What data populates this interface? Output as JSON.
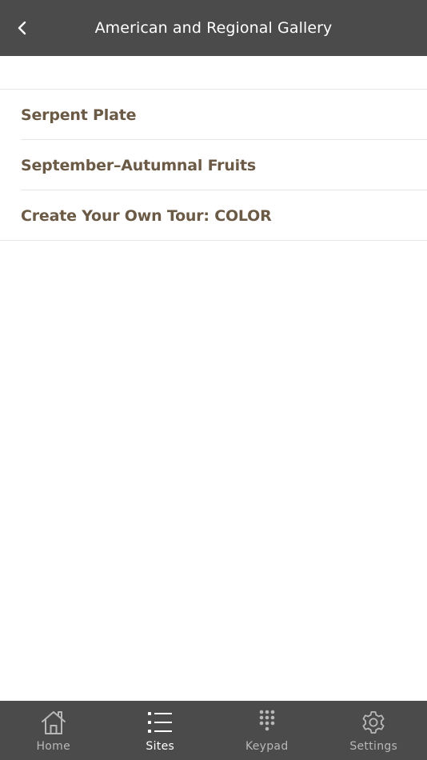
{
  "header": {
    "title": "American and Regional Gallery",
    "back_icon": "chevron-left-icon"
  },
  "list": {
    "items": [
      {
        "label": "Serpent Plate"
      },
      {
        "label": "September–Autumnal Fruits"
      },
      {
        "label": "Create Your Own Tour: COLOR"
      }
    ]
  },
  "tabbar": {
    "active": "Sites",
    "tabs": [
      {
        "label": "Home",
        "icon": "home-icon"
      },
      {
        "label": "Sites",
        "icon": "list-icon"
      },
      {
        "label": "Keypad",
        "icon": "keypad-icon"
      },
      {
        "label": "Settings",
        "icon": "gear-icon"
      }
    ]
  },
  "colors": {
    "header_bg": "#4b4b4b",
    "item_text": "#6b5a45",
    "tab_inactive": "#b8b8b8",
    "tab_active": "#ffffff"
  }
}
